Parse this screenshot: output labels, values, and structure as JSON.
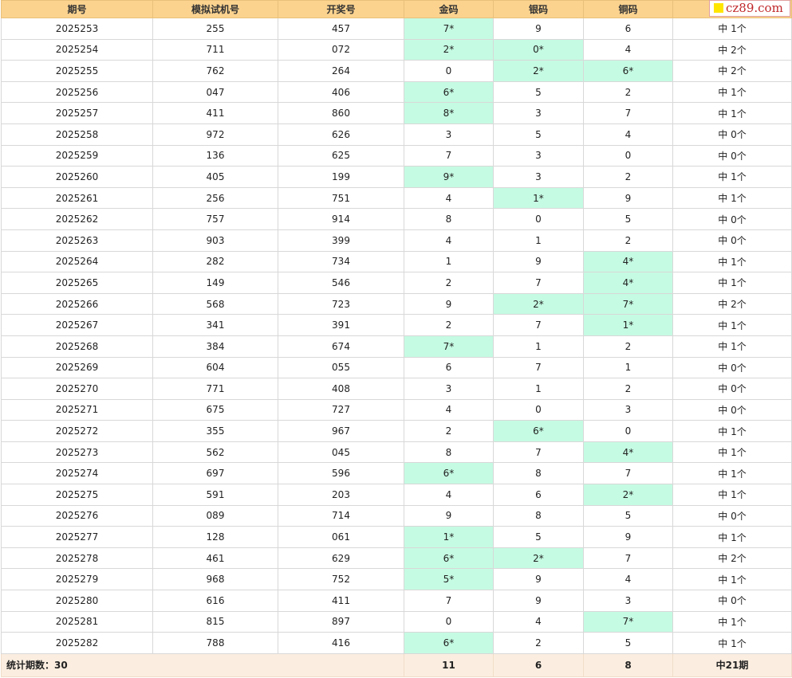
{
  "headers": [
    "期号",
    "模拟试机号",
    "开奖号",
    "金码",
    "银码",
    "铜码",
    ""
  ],
  "logo": "cz89.com",
  "rows": [
    {
      "period": "2025253",
      "sim": "255",
      "draw": "457",
      "gold": "7*",
      "silver": "9",
      "copper": "6",
      "result": "中 1个"
    },
    {
      "period": "2025254",
      "sim": "711",
      "draw": "072",
      "gold": "2*",
      "silver": "0*",
      "copper": "4",
      "result": "中 2个"
    },
    {
      "period": "2025255",
      "sim": "762",
      "draw": "264",
      "gold": "0",
      "silver": "2*",
      "copper": "6*",
      "result": "中 2个"
    },
    {
      "period": "2025256",
      "sim": "047",
      "draw": "406",
      "gold": "6*",
      "silver": "5",
      "copper": "2",
      "result": "中 1个"
    },
    {
      "period": "2025257",
      "sim": "411",
      "draw": "860",
      "gold": "8*",
      "silver": "3",
      "copper": "7",
      "result": "中 1个"
    },
    {
      "period": "2025258",
      "sim": "972",
      "draw": "626",
      "gold": "3",
      "silver": "5",
      "copper": "4",
      "result": "中 0个"
    },
    {
      "period": "2025259",
      "sim": "136",
      "draw": "625",
      "gold": "7",
      "silver": "3",
      "copper": "0",
      "result": "中 0个"
    },
    {
      "period": "2025260",
      "sim": "405",
      "draw": "199",
      "gold": "9*",
      "silver": "3",
      "copper": "2",
      "result": "中 1个"
    },
    {
      "period": "2025261",
      "sim": "256",
      "draw": "751",
      "gold": "4",
      "silver": "1*",
      "copper": "9",
      "result": "中 1个"
    },
    {
      "period": "2025262",
      "sim": "757",
      "draw": "914",
      "gold": "8",
      "silver": "0",
      "copper": "5",
      "result": "中 0个"
    },
    {
      "period": "2025263",
      "sim": "903",
      "draw": "399",
      "gold": "4",
      "silver": "1",
      "copper": "2",
      "result": "中 0个"
    },
    {
      "period": "2025264",
      "sim": "282",
      "draw": "734",
      "gold": "1",
      "silver": "9",
      "copper": "4*",
      "result": "中 1个"
    },
    {
      "period": "2025265",
      "sim": "149",
      "draw": "546",
      "gold": "2",
      "silver": "7",
      "copper": "4*",
      "result": "中 1个"
    },
    {
      "period": "2025266",
      "sim": "568",
      "draw": "723",
      "gold": "9",
      "silver": "2*",
      "copper": "7*",
      "result": "中 2个"
    },
    {
      "period": "2025267",
      "sim": "341",
      "draw": "391",
      "gold": "2",
      "silver": "7",
      "copper": "1*",
      "result": "中 1个"
    },
    {
      "period": "2025268",
      "sim": "384",
      "draw": "674",
      "gold": "7*",
      "silver": "1",
      "copper": "2",
      "result": "中 1个"
    },
    {
      "period": "2025269",
      "sim": "604",
      "draw": "055",
      "gold": "6",
      "silver": "7",
      "copper": "1",
      "result": "中 0个"
    },
    {
      "period": "2025270",
      "sim": "771",
      "draw": "408",
      "gold": "3",
      "silver": "1",
      "copper": "2",
      "result": "中 0个"
    },
    {
      "period": "2025271",
      "sim": "675",
      "draw": "727",
      "gold": "4",
      "silver": "0",
      "copper": "3",
      "result": "中 0个"
    },
    {
      "period": "2025272",
      "sim": "355",
      "draw": "967",
      "gold": "2",
      "silver": "6*",
      "copper": "0",
      "result": "中 1个"
    },
    {
      "period": "2025273",
      "sim": "562",
      "draw": "045",
      "gold": "8",
      "silver": "7",
      "copper": "4*",
      "result": "中 1个"
    },
    {
      "period": "2025274",
      "sim": "697",
      "draw": "596",
      "gold": "6*",
      "silver": "8",
      "copper": "7",
      "result": "中 1个"
    },
    {
      "period": "2025275",
      "sim": "591",
      "draw": "203",
      "gold": "4",
      "silver": "6",
      "copper": "2*",
      "result": "中 1个"
    },
    {
      "period": "2025276",
      "sim": "089",
      "draw": "714",
      "gold": "9",
      "silver": "8",
      "copper": "5",
      "result": "中 0个"
    },
    {
      "period": "2025277",
      "sim": "128",
      "draw": "061",
      "gold": "1*",
      "silver": "5",
      "copper": "9",
      "result": "中 1个"
    },
    {
      "period": "2025278",
      "sim": "461",
      "draw": "629",
      "gold": "6*",
      "silver": "2*",
      "copper": "7",
      "result": "中 2个"
    },
    {
      "period": "2025279",
      "sim": "968",
      "draw": "752",
      "gold": "5*",
      "silver": "9",
      "copper": "4",
      "result": "中 1个"
    },
    {
      "period": "2025280",
      "sim": "616",
      "draw": "411",
      "gold": "7",
      "silver": "9",
      "copper": "3",
      "result": "中 0个"
    },
    {
      "period": "2025281",
      "sim": "815",
      "draw": "897",
      "gold": "0",
      "silver": "4",
      "copper": "7*",
      "result": "中 1个"
    },
    {
      "period": "2025282",
      "sim": "788",
      "draw": "416",
      "gold": "6*",
      "silver": "2",
      "copper": "5",
      "result": "中 1个"
    }
  ],
  "summary": {
    "label": "统计期数：30",
    "gold": "11",
    "silver": "6",
    "copper": "8",
    "total": "中21期"
  },
  "colors": {
    "header_bg": "#fbd38f",
    "hit_bg": "#c5fbe3",
    "footer_bg": "#fbeee0"
  }
}
